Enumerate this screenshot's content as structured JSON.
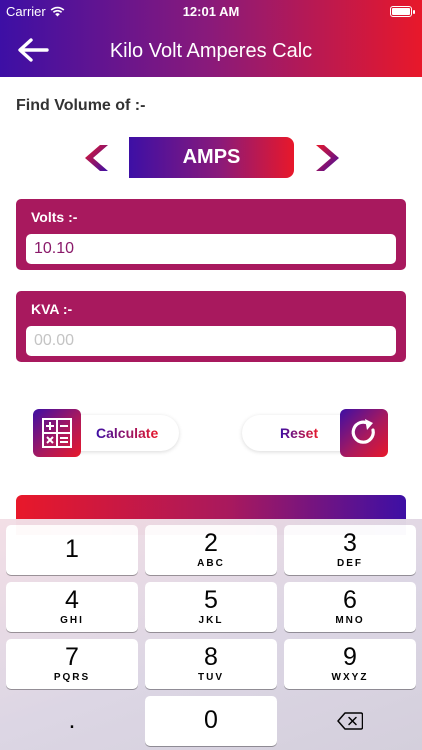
{
  "status_bar": {
    "carrier": "Carrier",
    "time": "12:01 AM"
  },
  "header": {
    "title": "Kilo Volt Amperes Calc"
  },
  "find": {
    "label": "Find Volume of :-"
  },
  "selector": {
    "current": "AMPS"
  },
  "volts": {
    "label": "Volts :-",
    "value": "10.10",
    "placeholder": ""
  },
  "kva": {
    "label": "KVA :-",
    "value": "",
    "placeholder": "00.00"
  },
  "actions": {
    "calculate_label": "Calculate",
    "reset_label": "Reset"
  },
  "keyboard": {
    "keys": [
      {
        "digit": "1",
        "letters": ""
      },
      {
        "digit": "2",
        "letters": "ABC"
      },
      {
        "digit": "3",
        "letters": "DEF"
      },
      {
        "digit": "4",
        "letters": "GHI"
      },
      {
        "digit": "5",
        "letters": "JKL"
      },
      {
        "digit": "6",
        "letters": "MNO"
      },
      {
        "digit": "7",
        "letters": "PQRS"
      },
      {
        "digit": "8",
        "letters": "TUV"
      },
      {
        "digit": "9",
        "letters": "WXYZ"
      },
      {
        "digit": ".",
        "letters": ""
      },
      {
        "digit": "0",
        "letters": ""
      }
    ]
  },
  "colors": {
    "gradient_start": "#3d0fa5",
    "gradient_end": "#e8182a",
    "card": "#a8195e"
  }
}
